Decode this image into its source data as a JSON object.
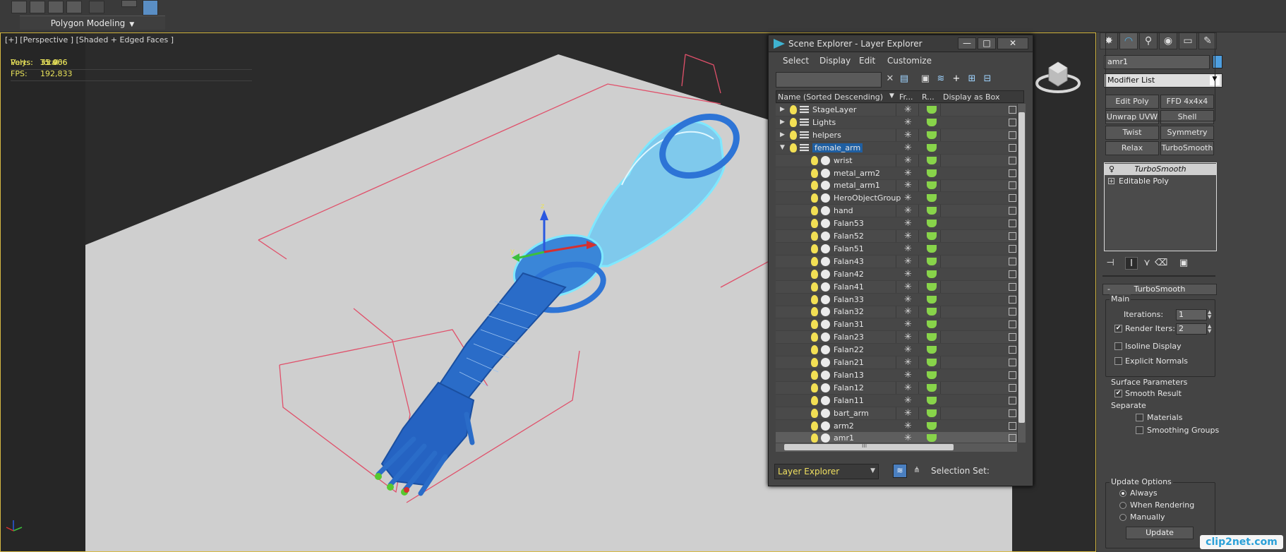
{
  "toolbar": {
    "ribbon_label": "Polygon Modeling"
  },
  "viewport": {
    "label": "[+] [Perspective ] [Shaded + Edged Faces ]",
    "stats": {
      "total_label": "Total",
      "polys_label": "Polys:",
      "polys_value": "31 406",
      "verts_label": "Verts:",
      "verts_value": "35 066",
      "fps_label": "FPS:",
      "fps_value": "192,833"
    },
    "axis_labels": {
      "x": "x",
      "y": "y",
      "z": "z"
    }
  },
  "watermark": "clip2net.com",
  "scene_explorer": {
    "title": "Scene Explorer - Layer Explorer",
    "window_buttons": {
      "minimize": "—",
      "maximize": "□",
      "close": "✕"
    },
    "menu": [
      "Select",
      "Display",
      "Edit",
      "Customize"
    ],
    "columns": {
      "name": "Name (Sorted Descending)",
      "freeze": "Fr...",
      "render": "R...",
      "box": "Display as Box"
    },
    "rows": [
      {
        "name": "StageLayer",
        "type": "layer",
        "expander": "▶"
      },
      {
        "name": "Lights",
        "type": "layer",
        "expander": "▶"
      },
      {
        "name": "helpers",
        "type": "layer",
        "expander": "▶"
      },
      {
        "name": "female_arm",
        "type": "layer",
        "expander": "▼",
        "highlight": true
      },
      {
        "name": "wrist",
        "type": "object"
      },
      {
        "name": "metal_arm2",
        "type": "object"
      },
      {
        "name": "metal_arm1",
        "type": "object"
      },
      {
        "name": "HeroObjectGroup",
        "type": "group"
      },
      {
        "name": "hand",
        "type": "object"
      },
      {
        "name": "Falan53",
        "type": "object"
      },
      {
        "name": "Falan52",
        "type": "object"
      },
      {
        "name": "Falan51",
        "type": "object"
      },
      {
        "name": "Falan43",
        "type": "object"
      },
      {
        "name": "Falan42",
        "type": "object"
      },
      {
        "name": "Falan41",
        "type": "object"
      },
      {
        "name": "Falan33",
        "type": "object"
      },
      {
        "name": "Falan32",
        "type": "object"
      },
      {
        "name": "Falan31",
        "type": "object"
      },
      {
        "name": "Falan23",
        "type": "object"
      },
      {
        "name": "Falan22",
        "type": "object"
      },
      {
        "name": "Falan21",
        "type": "object"
      },
      {
        "name": "Falan13",
        "type": "object"
      },
      {
        "name": "Falan12",
        "type": "object"
      },
      {
        "name": "Falan11",
        "type": "object"
      },
      {
        "name": "bart_arm",
        "type": "object"
      },
      {
        "name": "arm2",
        "type": "object"
      },
      {
        "name": "amr1",
        "type": "object",
        "selected": true
      }
    ],
    "footer": {
      "explorer_select": "Layer Explorer",
      "selection_set_label": "Selection Set:"
    },
    "hscroll_grip": "III"
  },
  "command_panel": {
    "object_name": "amr1",
    "object_color": "#4e9fe0",
    "modifier_list": "Modifier List",
    "modifier_buttons": [
      "Edit Poly",
      "FFD 4x4x4",
      "Unwrap UVW",
      "Shell",
      "Twist",
      "Symmetry",
      "Relax",
      "TurboSmooth"
    ],
    "stack": [
      {
        "label": "TurboSmooth",
        "active": true
      },
      {
        "label": "Editable Poly",
        "active": false
      }
    ],
    "turbosmooth": {
      "header": "TurboSmooth",
      "collapse": "-",
      "main_group": "Main",
      "iterations_label": "Iterations:",
      "iterations_value": "1",
      "render_iters_label": "Render Iters:",
      "render_iters_value": "2",
      "render_iters_checked": true,
      "isoline_label": "Isoline Display",
      "isoline_checked": false,
      "explicit_normals_label": "Explicit Normals",
      "explicit_normals_checked": false,
      "surface_group": "Surface Parameters",
      "smooth_result_label": "Smooth Result",
      "smooth_result_checked": true,
      "separate_label": "Separate",
      "materials_label": "Materials",
      "smoothing_groups_label": "Smoothing Groups",
      "update_group": "Update Options",
      "always_label": "Always",
      "when_rendering_label": "When Rendering",
      "manually_label": "Manually",
      "update_mode": "Always",
      "update_button": "Update"
    }
  },
  "colors": {
    "viewport_border": "#d6b842",
    "stats_text": "#e9e35a",
    "mesh_wire": "#1e5fc8",
    "selection_cyan": "#7fe8ff",
    "bounds_pink": "#e0506a",
    "floor": "#d0d0d0"
  }
}
